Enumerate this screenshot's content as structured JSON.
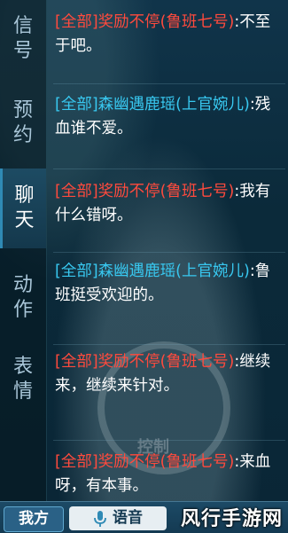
{
  "tabs": [
    {
      "label": "信号",
      "active": false
    },
    {
      "label": "预约",
      "active": false
    },
    {
      "label": "聊天",
      "active": true
    },
    {
      "label": "动作",
      "active": false
    },
    {
      "label": "表情",
      "active": false
    }
  ],
  "messages": [
    {
      "channel": "[全部]",
      "sender": "奖励不停(鲁班七号)",
      "text": ":不至于吧。",
      "color": "#ff4a3d"
    },
    {
      "channel": "[全部]",
      "sender": "森幽遇鹿瑶(上官婉儿)",
      "text": ":残血谁不爱。",
      "color": "#38c8f0"
    },
    {
      "channel": "[全部]",
      "sender": "奖励不停(鲁班七号)",
      "text": ":我有什么错呀。",
      "color": "#ff4a3d"
    },
    {
      "channel": "[全部]",
      "sender": "森幽遇鹿瑶(上官婉儿)",
      "text": ":鲁班挺受欢迎的。",
      "color": "#38c8f0"
    },
    {
      "channel": "[全部]",
      "sender": "奖励不停(鲁班七号)",
      "text": ":继续来，继续来针对。",
      "color": "#ff4a3d"
    },
    {
      "channel": "[全部]",
      "sender": "奖励不停(鲁班七号)",
      "text": ":来血呀，有本事。",
      "color": "#ff4a3d"
    }
  ],
  "background_text": "控制",
  "bottom": {
    "channel_button": "我方",
    "voice_button": "语音",
    "mic_icon": "mic-icon"
  },
  "watermark": "风行手游网"
}
